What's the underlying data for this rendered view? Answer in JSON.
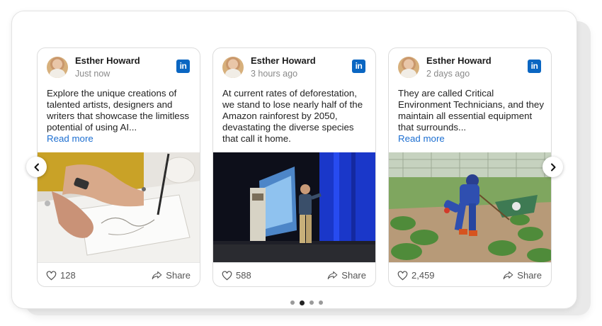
{
  "colors": {
    "accent": "#0a66c2",
    "link": "#1d6fd1",
    "muted": "#8a8a8a"
  },
  "posts": [
    {
      "author": "Esther Howard",
      "time": "Just now",
      "network_icon": "linkedin-icon",
      "text": "Explore the unique creations of talented artists, designers and writers that showcase the limitless potential of using AI...",
      "read_more": "Read more",
      "image": "hand-drawing-sketch",
      "likes": "128",
      "share": "Share"
    },
    {
      "author": "Esther Howard",
      "time": "3 hours ago",
      "network_icon": "linkedin-icon",
      "text": "At current rates of deforestation, we stand to lose nearly half of the Amazon rainforest by 2050, devastating the diverse species that call it home.",
      "image": "speaker-on-stage",
      "likes": "588",
      "share": "Share"
    },
    {
      "author": "Esther Howard",
      "time": "2 days ago",
      "network_icon": "linkedin-icon",
      "text": "They are called Critical Environment Technicians, and they maintain all essential equipment that surrounds...",
      "read_more": "Read more",
      "image": "worker-in-field",
      "likes": "2,459",
      "share": "Share"
    }
  ],
  "carousel": {
    "prev_icon": "chevron-left-icon",
    "next_icon": "chevron-right-icon",
    "dots": [
      false,
      true,
      false,
      false
    ]
  }
}
